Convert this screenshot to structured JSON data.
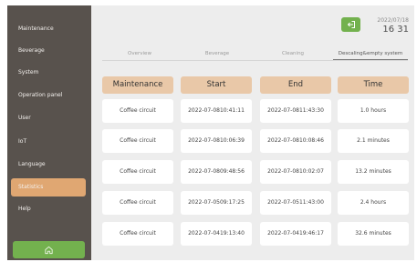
{
  "sidebar": {
    "items": [
      {
        "label": "Maintenance"
      },
      {
        "label": "Beverage"
      },
      {
        "label": "System"
      },
      {
        "label": "Operation panel"
      },
      {
        "label": "User"
      },
      {
        "label": "IoT"
      },
      {
        "label": "Language"
      },
      {
        "label": "Statistics",
        "active": true
      },
      {
        "label": "Help"
      }
    ],
    "home_icon": "home-icon"
  },
  "header": {
    "date": "2022/07/18",
    "time": "16 31",
    "exit_icon": "exit-icon"
  },
  "tabs": [
    {
      "label": "Overview"
    },
    {
      "label": "Beverage"
    },
    {
      "label": "Cleaning"
    },
    {
      "label": "Descaling&empty system",
      "active": true
    }
  ],
  "table": {
    "columns": [
      "Maintenance",
      "Start",
      "End",
      "Time"
    ],
    "rows": [
      {
        "maintenance": "Coffee circuit",
        "start_date": "2022-07-08",
        "start_time": "10:41:11",
        "end_date": "2022-07-08",
        "end_time": "11:43:30",
        "time": "1.0 hours"
      },
      {
        "maintenance": "Coffee circuit",
        "start_date": "2022-07-08",
        "start_time": "10:06:39",
        "end_date": "2022-07-08",
        "end_time": "10:08:46",
        "time": "2.1 minutes"
      },
      {
        "maintenance": "Coffee circuit",
        "start_date": "2022-07-08",
        "start_time": "09:48:56",
        "end_date": "2022-07-08",
        "end_time": "10:02:07",
        "time": "13.2 minutes"
      },
      {
        "maintenance": "Coffee circuit",
        "start_date": "2022-07-05",
        "start_time": "09:17:25",
        "end_date": "2022-07-05",
        "end_time": "11:43:00",
        "time": "2.4 hours"
      },
      {
        "maintenance": "Coffee circuit",
        "start_date": "2022-07-04",
        "start_time": "19:13:40",
        "end_date": "2022-07-04",
        "end_time": "19:46:17",
        "time": "32.6 minutes"
      }
    ]
  },
  "colors": {
    "sidebar_bg": "#58524d",
    "active_item": "#e0a772",
    "header_cell": "#e9c8a8",
    "accent_green": "#73b14e",
    "content_bg": "#ededed"
  }
}
